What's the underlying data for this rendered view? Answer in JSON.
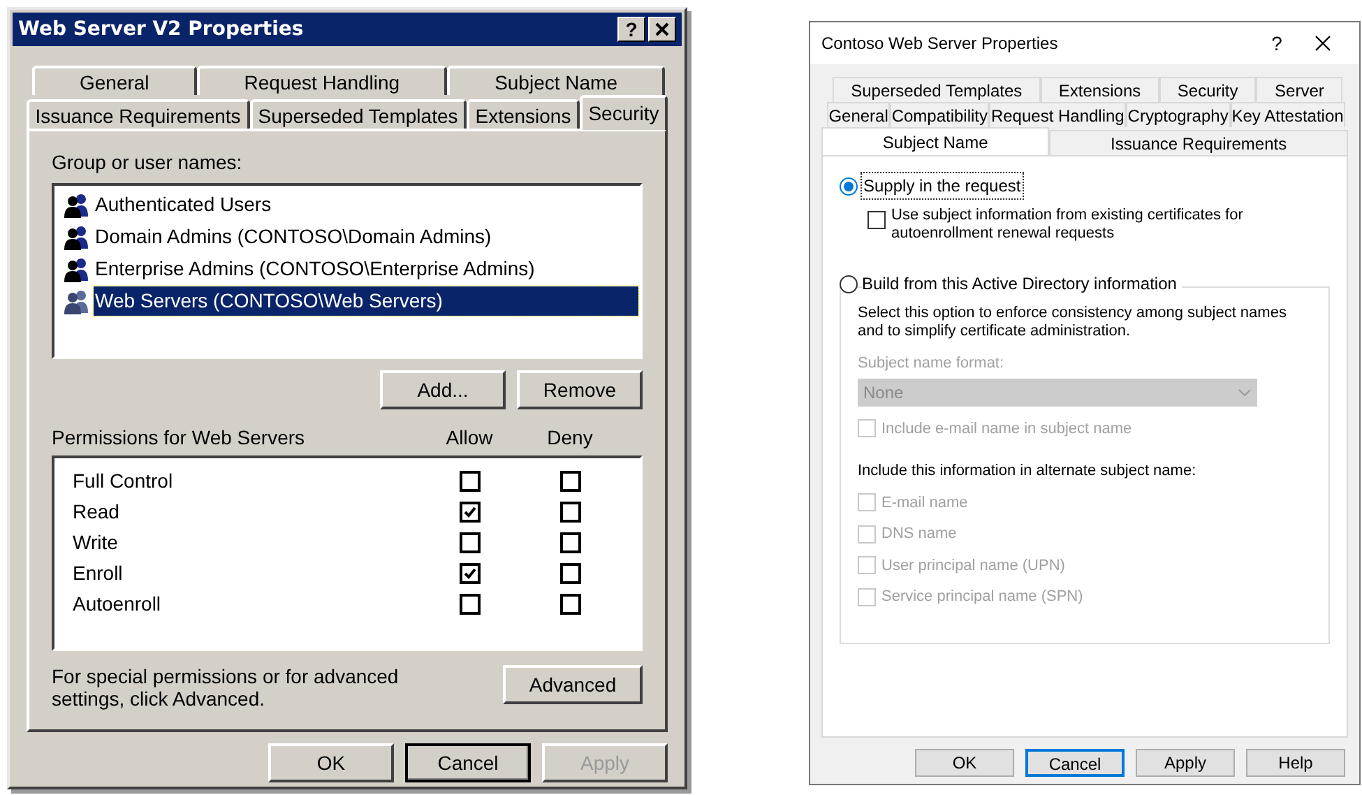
{
  "dialogs": [
    {
      "kind": "classic",
      "title": "Web Server V2 Properties",
      "help": "?",
      "tab_rows": [
        [
          {
            "label": "General",
            "selected": false
          },
          {
            "label": "Request Handling",
            "selected": false
          },
          {
            "label": "Subject Name",
            "selected": false
          }
        ],
        [
          {
            "label": "Issuance Requirements",
            "selected": false
          },
          {
            "label": "Superseded Templates",
            "selected": false
          },
          {
            "label": "Extensions",
            "selected": false
          },
          {
            "label": "Security",
            "selected": true
          }
        ]
      ],
      "group_label": "Group or user names:",
      "groups": [
        {
          "name": "Authenticated Users",
          "selected": false
        },
        {
          "name": "Domain Admins (CONTOSO\\Domain Admins)",
          "selected": false
        },
        {
          "name": "Enterprise Admins (CONTOSO\\Enterprise Admins)",
          "selected": false
        },
        {
          "name": "Web Servers (CONTOSO\\Web Servers)",
          "selected": true
        }
      ],
      "group_buttons": [
        "Add...",
        "Remove"
      ],
      "permissions_label": "Permissions for Web Servers",
      "columns": [
        "Allow",
        "Deny"
      ],
      "permissions": [
        {
          "name": "Full Control",
          "allow": false,
          "deny": false
        },
        {
          "name": "Read",
          "allow": true,
          "deny": false
        },
        {
          "name": "Write",
          "allow": false,
          "deny": false
        },
        {
          "name": "Enroll",
          "allow": true,
          "deny": false
        },
        {
          "name": "Autoenroll",
          "allow": false,
          "deny": false
        }
      ],
      "note": "For special permissions or for advanced settings, click Advanced.",
      "advanced": "Advanced",
      "buttons": [
        {
          "label": "OK",
          "default": false,
          "disabled": false
        },
        {
          "label": "Cancel",
          "default": true,
          "disabled": false
        },
        {
          "label": "Apply",
          "default": false,
          "disabled": true
        }
      ]
    },
    {
      "kind": "modern",
      "title": "Contoso Web Server Properties",
      "help": "?",
      "tab_rows": [
        [
          {
            "label": "Superseded Templates",
            "selected": false
          },
          {
            "label": "Extensions",
            "selected": false
          },
          {
            "label": "Security",
            "selected": false
          },
          {
            "label": "Server",
            "selected": false
          }
        ],
        [
          {
            "label": "General",
            "selected": false
          },
          {
            "label": "Compatibility",
            "selected": false
          },
          {
            "label": "Request Handling",
            "selected": false
          },
          {
            "label": "Cryptography",
            "selected": false
          },
          {
            "label": "Key Attestation",
            "selected": false
          }
        ],
        [
          {
            "label": "Subject Name",
            "selected": true
          },
          {
            "label": "Issuance Requirements",
            "selected": false
          }
        ]
      ],
      "supply": {
        "label": "Supply in the request",
        "selected": true,
        "option": {
          "label": "Use subject information from existing certificates for autoenrollment renewal requests",
          "checked": false,
          "disabled": false
        }
      },
      "build": {
        "label": "Build from this Active Directory information",
        "selected": false,
        "description": "Select this option to enforce consistency among subject names and to simplify certificate administration.",
        "format_label": "Subject name format:",
        "format_value": "None",
        "disabled": true,
        "email_option": {
          "label": "Include e-mail name in subject name",
          "checked": false,
          "disabled": true
        },
        "alt_label": "Include this information in alternate subject name:",
        "alt_options": [
          {
            "label": "E-mail name",
            "checked": false,
            "disabled": true
          },
          {
            "label": "DNS name",
            "checked": false,
            "disabled": true
          },
          {
            "label": "User principal name (UPN)",
            "checked": false,
            "disabled": true
          },
          {
            "label": "Service principal name (SPN)",
            "checked": false,
            "disabled": true
          }
        ]
      },
      "buttons": [
        {
          "label": "OK",
          "default": false,
          "disabled": false
        },
        {
          "label": "Cancel",
          "default": true,
          "disabled": false
        },
        {
          "label": "Apply",
          "default": false,
          "disabled": false
        },
        {
          "label": "Help",
          "default": false,
          "disabled": false
        }
      ]
    }
  ]
}
